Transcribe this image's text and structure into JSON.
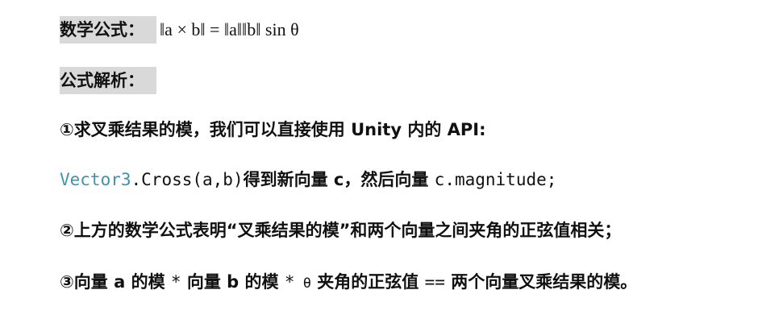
{
  "formula_label": "数学公式：",
  "formula": "‖a × b‖ = ‖a‖‖b‖ sin θ",
  "analysis_label": "公式解析：",
  "point1": "①求叉乘结果的模，我们可以直接使用 Unity 内的 API:",
  "code_class": "Vector3",
  "code_call": ".Cross(a,b)",
  "code_text1": "得到新向量 c，然后向量 ",
  "code_prop": "c.magnitude;",
  "point2": "②上方的数学公式表明“叉乘结果的模”和两个向量之间夹角的正弦值相关；",
  "point3_a": "③向量 a 的模 ",
  "point3_star1": "*",
  "point3_b": " 向量 b 的模 ",
  "point3_star2": "*",
  "point3_theta": " θ",
  "point3_c": "夹角的正弦值 ",
  "point3_eq": "==",
  "point3_d": " 两个向量叉乘结果的模。"
}
